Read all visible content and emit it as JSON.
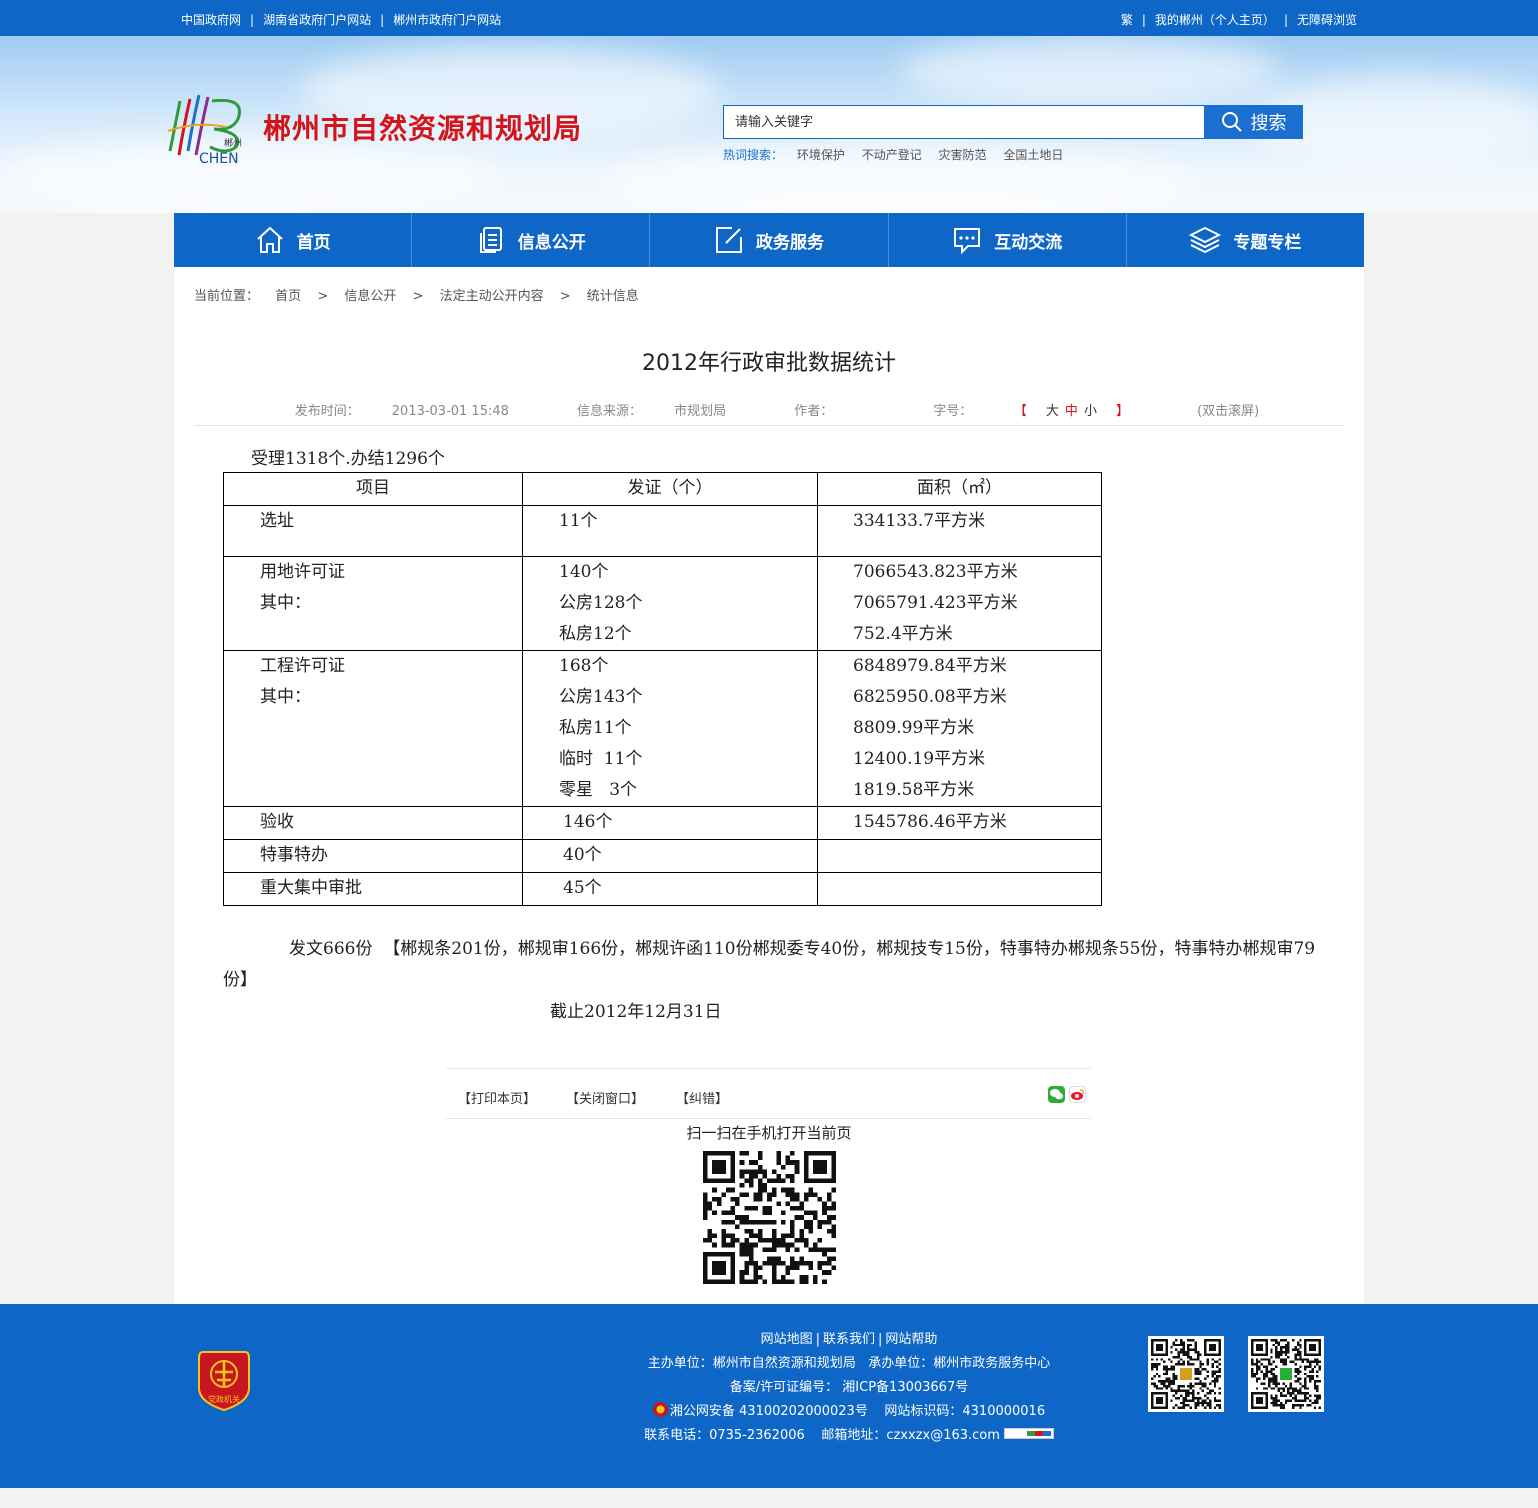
{
  "topbar": {
    "left_links": [
      "中国政府网",
      "湖南省政府门户网站",
      "郴州市政府门户网站"
    ],
    "right_links": [
      "繁",
      "我的郴州（个人主页）",
      "无障碍浏览"
    ]
  },
  "header": {
    "logo_text": "郴州",
    "logo_sub": "CHEN",
    "site_title": "郴州市自然资源和规划局",
    "search_placeholder": "请输入关键字",
    "search_button": "搜索",
    "hot_label": "热词搜索：",
    "hot_words": [
      "环境保护",
      "不动产登记",
      "灾害防范",
      "全国土地日"
    ]
  },
  "nav": {
    "items": [
      {
        "label": "首页",
        "icon": "home-icon"
      },
      {
        "label": "信息公开",
        "icon": "document-icon"
      },
      {
        "label": "政务服务",
        "icon": "edit-icon"
      },
      {
        "label": "互动交流",
        "icon": "chat-icon"
      },
      {
        "label": "专题专栏",
        "icon": "layers-icon"
      }
    ]
  },
  "breadcrumb": {
    "label": "当前位置：",
    "items": [
      "首页",
      "信息公开",
      "法定主动公开内容",
      "统计信息"
    ],
    "separator": ">"
  },
  "article": {
    "title": "2012年行政审批数据统计",
    "publish_time_label": "发布时间：",
    "publish_time": "2013-03-01 15:48",
    "source_label": "信息来源：",
    "source": "市规划局",
    "author_label": "作者：",
    "author": "",
    "font_size_label": "字号：",
    "font_sizes": [
      "大",
      "中",
      "小"
    ],
    "bracket_open": "【",
    "bracket_close": "】",
    "fullscreen": "(双击滚屏)",
    "intro": "受理1318个.办结1296个",
    "table": {
      "headers": [
        "项目",
        "发证（个）",
        "面积（㎡）"
      ],
      "rows": [
        {
          "item": [
            "选址",
            ""
          ],
          "count": [
            "11个"
          ],
          "area": [
            "334133.7平方米"
          ]
        },
        {
          "item": [
            "用地许可证",
            "其中："
          ],
          "count": [
            "140个",
            "公房128个",
            "私房12个"
          ],
          "area": [
            "7066543.823平方米",
            "7065791.423平方米",
            "752.4平方米"
          ]
        },
        {
          "item": [
            "工程许可证",
            "其中："
          ],
          "count": [
            "168个",
            "公房143个",
            "私房11个",
            "临时  11个",
            "零星   3个"
          ],
          "area": [
            "6848979.84平方米",
            "6825950.08平方米",
            "8809.99平方米",
            "12400.19平方米",
            "1819.58平方米"
          ]
        },
        {
          "item": [
            "验收"
          ],
          "count": [
            "146个"
          ],
          "area": [
            "1545786.46平方米"
          ]
        },
        {
          "item": [
            "特事特办"
          ],
          "count": [
            "40个"
          ],
          "area": [
            ""
          ]
        },
        {
          "item": [
            "重大集中审批"
          ],
          "count": [
            "45个"
          ],
          "area": [
            ""
          ]
        }
      ]
    },
    "paragraph": "发文666份  【郴规条201份，郴规审166份，郴规许函110份郴规委专40份，郴规技专15份，特事特办郴规条55份，特事特办郴规审79份】",
    "date_note": "截止2012年12月31日"
  },
  "tools": {
    "print": "【打印本页】",
    "close": "【关闭窗口】",
    "error": "【纠错】",
    "share_icons": [
      "wechat-icon",
      "weibo-icon"
    ],
    "scan_text": "扫一扫在手机打开当前页"
  },
  "footer": {
    "links": [
      "网站地图",
      "联系我们",
      "网站帮助"
    ],
    "host": "主办单位：郴州市自然资源和规划局   承办单位：郴州市政务服务中心",
    "icp": "备案/许可证编号： 湘ICP备13003667号",
    "police": "湘公网安备 43100202000023号",
    "site_code": "网站标识码：4310000016",
    "phone": "联系电话：0735-2362006",
    "email": "邮箱地址：czxxzx@163.com",
    "badge_text": "党政机关",
    "colors": {
      "primary": "#0e67c7",
      "title_red": "#d4141b"
    }
  }
}
